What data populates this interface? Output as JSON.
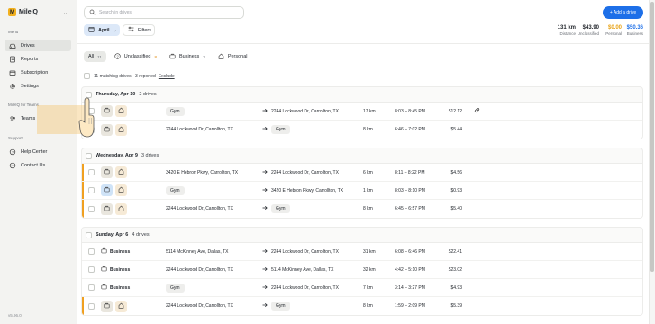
{
  "app": {
    "logo_letter": "M",
    "name": "MileIQ"
  },
  "sidebar": {
    "menu_label": "Menu",
    "items": [
      {
        "label": "Drives",
        "icon": "car-icon"
      },
      {
        "label": "Reports",
        "icon": "report-icon"
      },
      {
        "label": "Subscription",
        "icon": "subscription-icon"
      },
      {
        "label": "Settings",
        "icon": "gear-icon"
      }
    ],
    "teams_label": "MileIQ for Teams",
    "teams_item": "Teams",
    "support_label": "Support",
    "support_items": [
      {
        "label": "Help Center"
      },
      {
        "label": "Contact Us"
      }
    ],
    "version": "v5.96.0"
  },
  "search": {
    "placeholder": "Search in drives"
  },
  "toolbar": {
    "add_drive": "+ Add a drive",
    "month": "April",
    "filters": "Filters"
  },
  "stats": [
    {
      "value": "131 km",
      "label": "Distance",
      "color": "#1f2329"
    },
    {
      "value": "$43.90",
      "label": "Unclassified",
      "color": "#1f2329"
    },
    {
      "value": "$0.00",
      "label": "Personal",
      "color": "#e8a317"
    },
    {
      "value": "$50.36",
      "label": "Business",
      "color": "#1d6fe8"
    }
  ],
  "tabs": [
    {
      "label": "All",
      "count": "11"
    },
    {
      "label": "Unclassified",
      "count": "8"
    },
    {
      "label": "Business",
      "count": "3"
    },
    {
      "label": "Personal",
      "count": ""
    }
  ],
  "matching": {
    "text": "11 matching drives · 3 reported",
    "exclude": "Exclude"
  },
  "days": [
    {
      "title": "Thursday, Apr 10",
      "count": "2 drives",
      "drives": [
        {
          "from": "Gym",
          "from_chip": true,
          "to": "2244 Lockwood Dr, Carrollton, TX",
          "to_chip": false,
          "dist": "17 km",
          "time": "8:03 – 8:45 PM",
          "amount": "$12.12",
          "link": true,
          "unclassified": false
        },
        {
          "from": "2244 Lockwood Dr, Carrollton, TX",
          "from_chip": false,
          "to": "Gym",
          "to_chip": true,
          "dist": "8 km",
          "time": "6:46 – 7:02 PM",
          "amount": "$5.44",
          "link": false,
          "unclassified": false
        }
      ]
    },
    {
      "title": "Wednesday, Apr 9",
      "count": "3 drives",
      "drives": [
        {
          "from": "3420 E Hebron Pkwy, Carrollton, TX",
          "from_chip": false,
          "to": "2244 Lockwood Dr, Carrollton, TX",
          "to_chip": false,
          "dist": "6 km",
          "time": "8:11 – 8:22 PM",
          "amount": "$4.56",
          "link": false,
          "unclassified": true
        },
        {
          "from": "Gym",
          "from_chip": true,
          "to": "3420 E Hebron Pkwy, Carrollton, TX",
          "to_chip": false,
          "dist": "1 km",
          "time": "8:03 – 8:10 PM",
          "amount": "$0.93",
          "link": false,
          "unclassified": true,
          "highlight": true
        },
        {
          "from": "2244 Lockwood Dr, Carrollton, TX",
          "from_chip": false,
          "to": "Gym",
          "to_chip": true,
          "dist": "8 km",
          "time": "6:45 – 6:57 PM",
          "amount": "$5.40",
          "link": false,
          "unclassified": true
        }
      ]
    },
    {
      "title": "Sunday, Apr 6",
      "count": "4 drives",
      "drives": [
        {
          "business": "Business",
          "from": "5114 McKinney Ave, Dallas, TX",
          "from_chip": false,
          "to": "2244 Lockwood Dr, Carrollton, TX",
          "to_chip": false,
          "dist": "31 km",
          "time": "6:08 – 6:46 PM",
          "amount": "$22.41",
          "link": false,
          "unclassified": false
        },
        {
          "business": "Business",
          "from": "2244 Lockwood Dr, Carrollton, TX",
          "from_chip": false,
          "to": "5114 McKinney Ave, Dallas, TX",
          "to_chip": false,
          "dist": "32 km",
          "time": "4:42 – 5:10 PM",
          "amount": "$23.02",
          "link": false,
          "unclassified": false
        },
        {
          "business": "Business",
          "from": "Gym",
          "from_chip": true,
          "to": "2244 Lockwood Dr, Carrollton, TX",
          "to_chip": false,
          "dist": "7 km",
          "time": "3:14 – 3:27 PM",
          "amount": "$4.93",
          "link": false,
          "unclassified": false
        },
        {
          "from": "2244 Lockwood Dr, Carrollton, TX",
          "from_chip": false,
          "to": "Gym",
          "to_chip": true,
          "dist": "8 km",
          "time": "1:59 – 2:09 PM",
          "amount": "$5.39",
          "link": false,
          "unclassified": true
        }
      ]
    }
  ]
}
